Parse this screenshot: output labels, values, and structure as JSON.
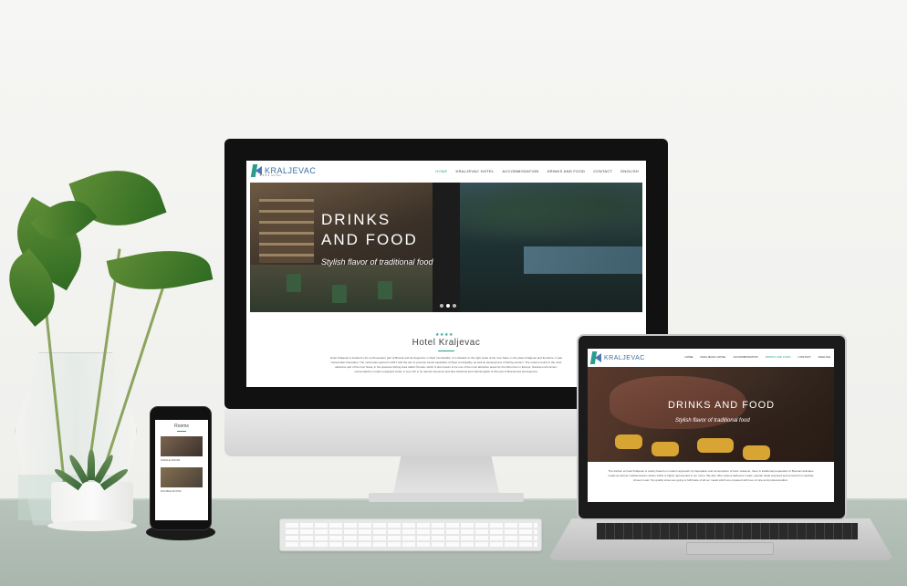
{
  "imac": {
    "logo_text": "KRALJEVAC",
    "logo_sub": "★★★★ HOTEL",
    "nav": [
      "HOME",
      "KRALJEVAC HOTEL",
      "ACCOMMODATION",
      "DRINKS AND FOOD",
      "CONTACT",
      "ENGLISH"
    ],
    "nav_active_index": 0,
    "hero_title_line1": "DRINKS",
    "hero_title_line2": "AND FOOD",
    "hero_subtitle": "Stylish flavor of traditional food",
    "stars": "★★★★",
    "section_title": "Hotel Kraljevac",
    "body_text": "Hotel Kraljevac is located in the north-western part of Bosnia and Herzegovina, in Ključ municipality. It is situated on the right coast of the river Sana, in the place Kraljevac and therefore, it was named after that place. The motel was opened in 2017 with the aim to promote tourist capacities of Ključ municipality, as well as development of fishing tourism. The motel is found in the most attractive part of the river Sana, in the spacious fishing area called Ćimeša, which is also known to be one of the most attractive areas for the fishermen in Europe. Natural environment, surrounded by modern equipped motel, is very rich in its natural resources and also historical and cultural sights of this part of Bosnia and Herzegovina."
  },
  "laptop": {
    "logo_text": "KRALJEVAC",
    "nav": [
      "HOME",
      "KRALJEVAC HOTEL",
      "ACCOMMODATION",
      "DRINKS AND FOOD",
      "CONTACT",
      "ENGLISH"
    ],
    "nav_active_index": 3,
    "hero_title": "DRINKS AND FOOD",
    "hero_subtitle": "Stylish flavor of traditional food",
    "body_text": "The kitchen at hotel Kraljevac is mainly based on modern approach of preparation and consumption of food. However, there is traditional preparation of Bosnian delicates meals as well as mediterranean cuisine which is highly represented in our menu. We also offer various barbecue meals, popular steak prepared and served from carefully chosen meat. Top quality wines are going to fulfil taste of all our meals which are prepared with love of nice and professionalism."
  },
  "phone": {
    "title": "Rooms",
    "room1": "SINGLE ROOM",
    "room2": "DOUBLE ROOM"
  },
  "colors": {
    "accent": "#2a9d8f",
    "logo_blue": "#3a6ea5"
  }
}
